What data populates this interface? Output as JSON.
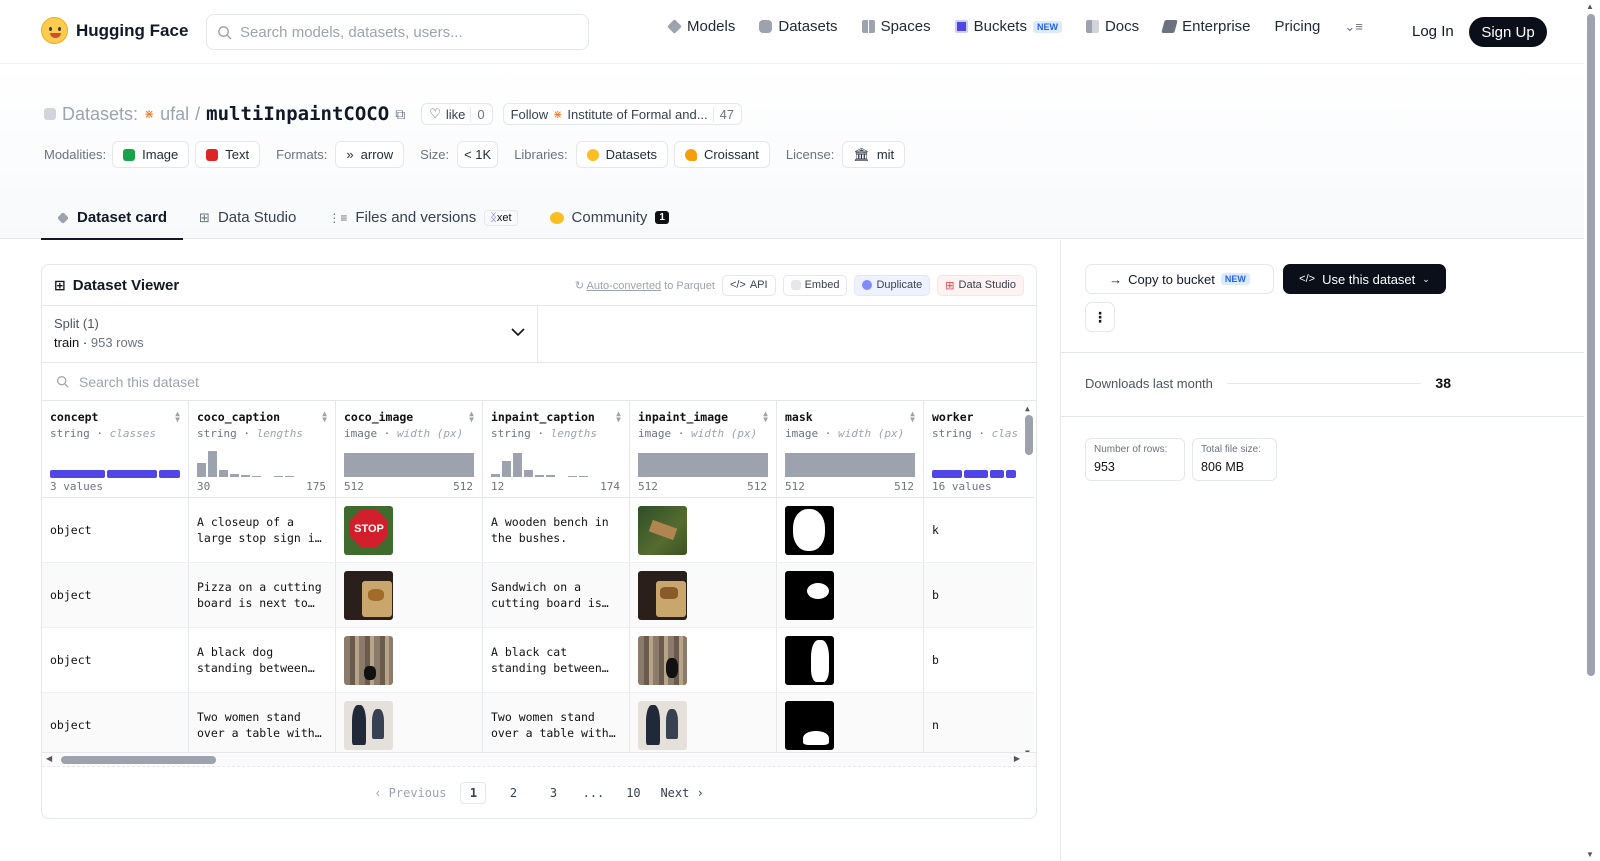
{
  "header": {
    "brand": "Hugging Face",
    "search_placeholder": "Search models, datasets, users...",
    "nav": [
      {
        "label": "Models",
        "icon": "models-icon",
        "color": "#9ca3af"
      },
      {
        "label": "Datasets",
        "icon": "datasets-icon",
        "color": "#9ca3af"
      },
      {
        "label": "Spaces",
        "icon": "spaces-icon",
        "color": "#9ca3af"
      },
      {
        "label": "Buckets",
        "icon": "buckets-icon",
        "color": "#4f46e5",
        "badge": "NEW"
      },
      {
        "label": "Docs",
        "icon": "docs-icon",
        "color": "#9ca3af"
      },
      {
        "label": "Enterprise",
        "icon": "enterprise-icon",
        "color": "#6b7280"
      },
      {
        "label": "Pricing"
      }
    ],
    "login": "Log In",
    "signup": "Sign Up"
  },
  "repo": {
    "prefix": "Datasets:",
    "owner": "ufal",
    "slash": "/",
    "name": "multiInpaintCOCO",
    "like_label": "like",
    "like_count": "0",
    "follow_label": "Follow",
    "org_name": "Institute of Formal and...",
    "follow_count": "47"
  },
  "meta": {
    "modalities_label": "Modalities:",
    "modalities": [
      "Image",
      "Text"
    ],
    "formats_label": "Formats:",
    "format": "arrow",
    "size_label": "Size:",
    "size": "< 1K",
    "libraries_label": "Libraries:",
    "libraries": [
      "Datasets",
      "Croissant"
    ],
    "license_label": "License:",
    "license": "mit"
  },
  "tabs": [
    {
      "label": "Dataset card",
      "active": true
    },
    {
      "label": "Data Studio"
    },
    {
      "label": "Files and versions",
      "badge": "xet"
    },
    {
      "label": "Community",
      "count": "1"
    }
  ],
  "viewer": {
    "title": "Dataset Viewer",
    "parquet_link": "Auto-converted",
    "parquet_suffix": "to Parquet",
    "buttons": [
      "API",
      "Embed",
      "Duplicate",
      "Data Studio"
    ],
    "split_label": "Split (1)",
    "split_value": "train",
    "split_rows": "953 rows",
    "search_placeholder": "Search this dataset",
    "columns": [
      {
        "name": "concept",
        "type": "string",
        "stat": "classes",
        "min": "3 values",
        "max": ""
      },
      {
        "name": "coco_caption",
        "type": "string",
        "stat": "lengths",
        "min": "30",
        "max": "175"
      },
      {
        "name": "coco_image",
        "type": "image",
        "stat": "width (px)",
        "min": "512",
        "max": "512"
      },
      {
        "name": "inpaint_caption",
        "type": "string",
        "stat": "lengths",
        "min": "12",
        "max": "174"
      },
      {
        "name": "inpaint_image",
        "type": "image",
        "stat": "width (px)",
        "min": "512",
        "max": "512"
      },
      {
        "name": "mask",
        "type": "image",
        "stat": "width (px)",
        "min": "512",
        "max": "512"
      },
      {
        "name": "worker",
        "type": "string",
        "stat": "clas",
        "min": "16 values",
        "max": ""
      }
    ],
    "rows": [
      {
        "concept": "object",
        "coco_caption": "A closeup of a large stop sign i…",
        "inpaint_caption": "A wooden bench in the bushes.",
        "worker": "k"
      },
      {
        "concept": "object",
        "coco_caption": "Pizza on a cutting board is next to…",
        "inpaint_caption": "Sandwich on a cutting board is…",
        "worker": "b"
      },
      {
        "concept": "object",
        "coco_caption": "A black dog standing between…",
        "inpaint_caption": "A black cat standing between…",
        "worker": "b"
      },
      {
        "concept": "object",
        "coco_caption": "Two women stand over a table with…",
        "inpaint_caption": "Two women stand over a table with…",
        "worker": "n"
      }
    ],
    "pager": {
      "prev": "Previous",
      "pages": [
        "1",
        "2",
        "3",
        "...",
        "10"
      ],
      "next": "Next",
      "current": "1"
    }
  },
  "sidebar": {
    "copy_label": "Copy to bucket",
    "copy_badge": "NEW",
    "use_label": "Use this dataset",
    "downloads_label": "Downloads last month",
    "downloads_value": "38",
    "rows_label": "Number of rows:",
    "rows_value": "953",
    "size_label": "Total file size:",
    "size_value": "806 MB"
  }
}
